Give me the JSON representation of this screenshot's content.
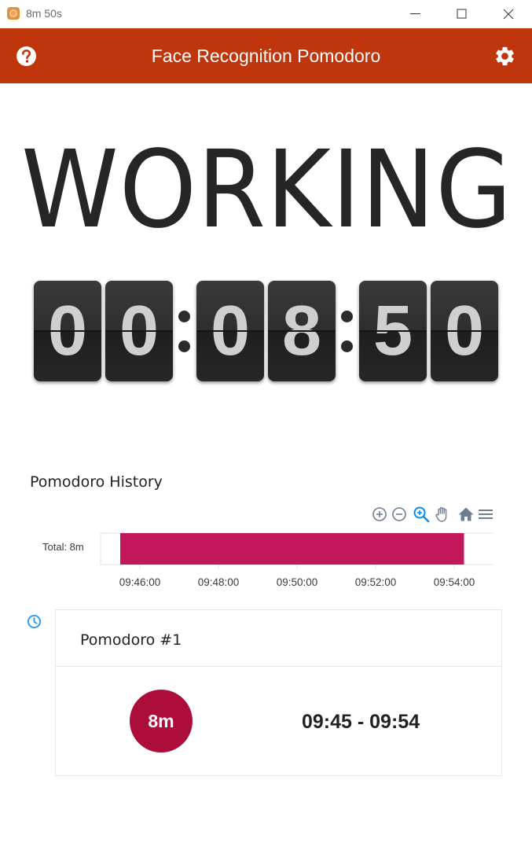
{
  "window": {
    "title": "8m 50s"
  },
  "appbar": {
    "title": "Face Recognition Pomodoro",
    "help_icon": "help-circle-icon",
    "settings_icon": "gear-icon",
    "color": "#bf360c"
  },
  "status": {
    "label": "WORKING"
  },
  "timer": {
    "digits": [
      "0",
      "0",
      "0",
      "8",
      "5",
      "0"
    ]
  },
  "history": {
    "title": "Pomodoro History",
    "toolbar_icons": [
      "zoom-in-icon",
      "zoom-out-icon",
      "magnifier-icon",
      "pan-hand-icon",
      "home-icon",
      "menu-icon"
    ],
    "chart_data": {
      "type": "bar",
      "orientation": "horizontal",
      "categories": [
        "Total: 8m"
      ],
      "series": [
        {
          "start": "09:45:30",
          "end": "09:54:15",
          "color": "#c2185b"
        }
      ],
      "xaxis": {
        "ticks": [
          "09:46:00",
          "09:48:00",
          "09:50:00",
          "09:52:00",
          "09:54:00"
        ],
        "range": [
          "09:45:00",
          "09:55:00"
        ]
      },
      "grid": false
    }
  },
  "timeline": {
    "icon": "clock-icon",
    "items": [
      {
        "title": "Pomodoro #1",
        "duration": "8m",
        "time_range": "09:45 - 09:54",
        "badge_color": "#ad0d3a"
      }
    ]
  }
}
